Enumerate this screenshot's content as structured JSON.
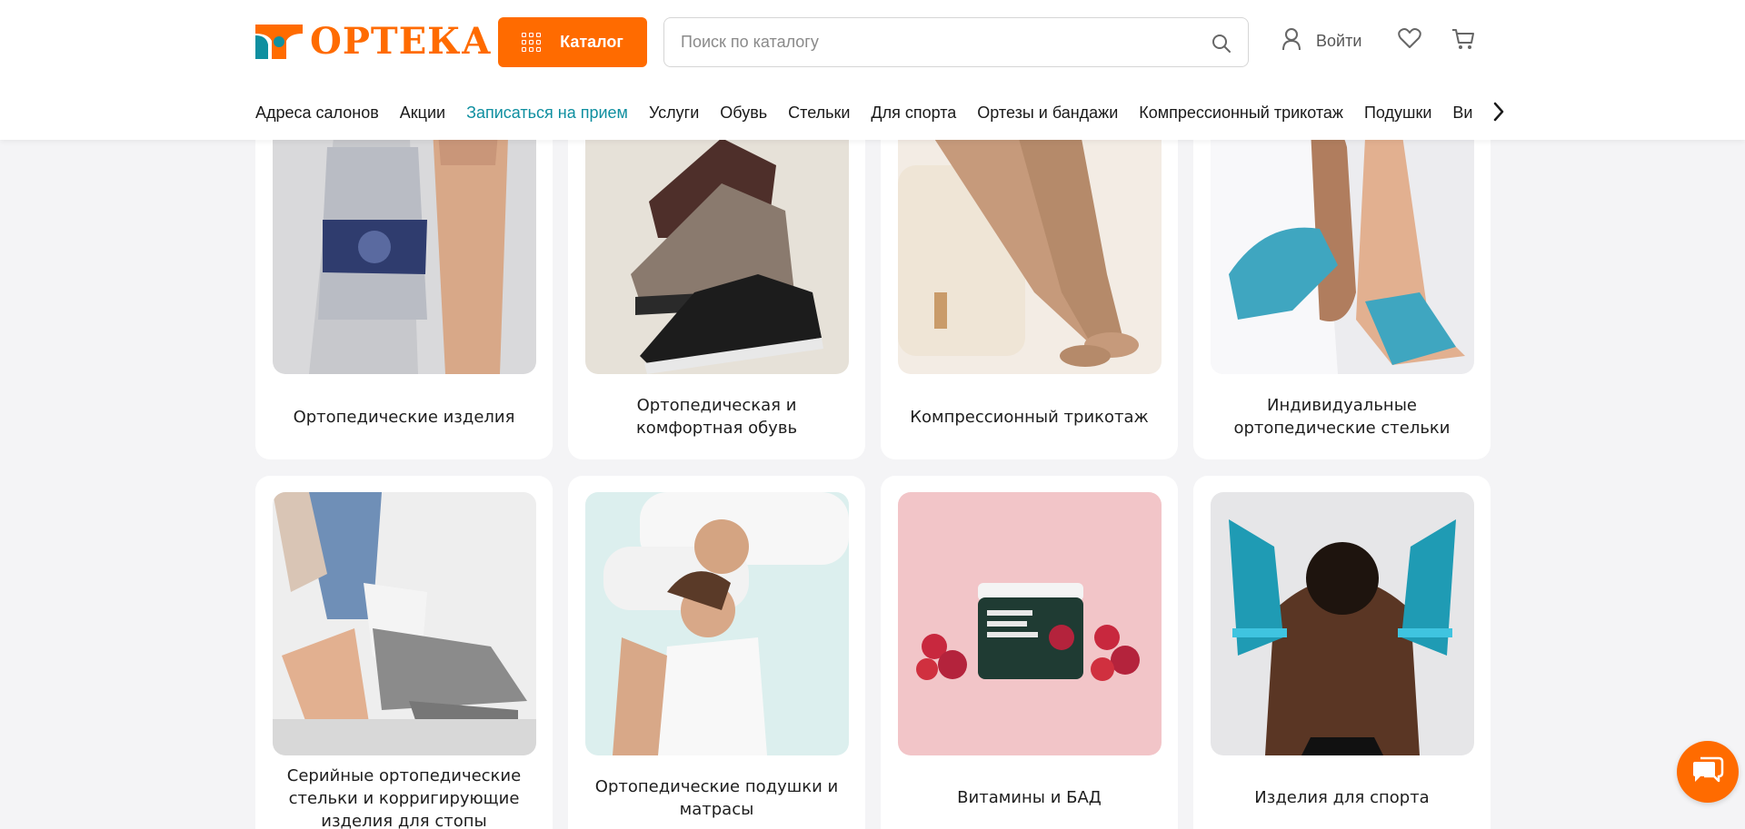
{
  "header": {
    "logo_text": "ОРТЕКА",
    "catalog_label": "Каталог",
    "search_placeholder": "Поиск по каталогу",
    "login_label": "Войти"
  },
  "nav": {
    "items": [
      {
        "label": "Адреса салонов"
      },
      {
        "label": "Акции"
      },
      {
        "label": "Записаться на прием"
      },
      {
        "label": "Услуги"
      },
      {
        "label": "Обувь"
      },
      {
        "label": "Стельки"
      },
      {
        "label": "Для спорта"
      },
      {
        "label": "Ортезы и бандажи"
      },
      {
        "label": "Компрессионный трикотаж"
      },
      {
        "label": "Подушки"
      },
      {
        "label": "Ви"
      }
    ]
  },
  "categories": [
    {
      "label": "Ортопедические изделия",
      "icon": "knee-brace-image"
    },
    {
      "label": "Ортопедическая и комфортная обувь",
      "icon": "shoes-image"
    },
    {
      "label": "Компрессионный трикотаж",
      "icon": "legs-stockings-image"
    },
    {
      "label": "Индивидуальные ортопедические стельки",
      "icon": "insole-fitting-image"
    },
    {
      "label": "Серийные ортопедические стельки и корригирующие изделия для стопы",
      "icon": "insole-shoe-image"
    },
    {
      "label": "Ортопедические подушки и матрасы",
      "icon": "couple-pillow-image"
    },
    {
      "label": "Витамины и БАД",
      "icon": "collagen-jar-image"
    },
    {
      "label": "Изделия для спорта",
      "icon": "sport-sleeves-image"
    }
  ],
  "colors": {
    "brand_orange": "#ff6b00",
    "brand_teal": "#0f8fa0",
    "page_bg": "#f4f4f6"
  }
}
